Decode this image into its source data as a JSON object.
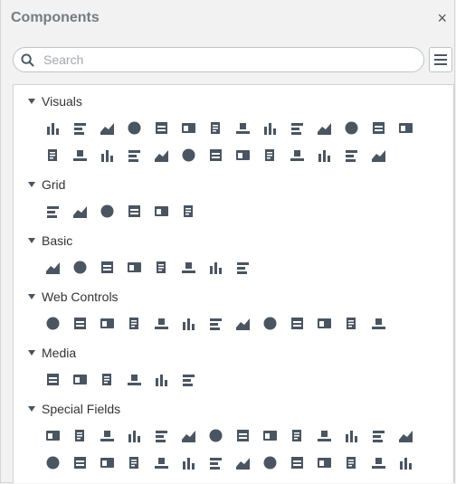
{
  "panel": {
    "title": "Components",
    "close_glyph": "×"
  },
  "search": {
    "placeholder": "Search",
    "value": ""
  },
  "sections": [
    {
      "label": "Visuals",
      "icons": [
        "bar-chart-icon",
        "stacked-bar-chart-icon",
        "100pct-stacked-bar-icon",
        "horizontal-bar-icon",
        "stacked-horizontal-bar-icon",
        "100pct-stacked-horizontal-icon",
        "line-chart-icon",
        "step-line-chart-icon",
        "jump-line-chart-icon",
        "area-chart-icon",
        "stacked-area-chart-icon",
        "100pct-area-chart-icon",
        "combo-chart-icon",
        "pie-chart-icon",
        "donut-chart-icon",
        "half-gauge-icon",
        "gauge-icon",
        "radial-gauge-icon",
        "bullet-icon",
        "dot-plot-icon",
        "scatter-chart-icon",
        "gantt-chart-icon",
        "bubble-chart-icon",
        "tree-chart-icon",
        "treemap-icon",
        "map-icon",
        "kpi-icon"
      ]
    },
    {
      "label": "Grid",
      "icons": [
        "table-icon",
        "freeform-table-icon",
        "crosstab-icon",
        "grouped-table-icon",
        "section-icon",
        "page-grid-icon"
      ]
    },
    {
      "label": "Basic",
      "icons": [
        "text-icon",
        "label-icon",
        "image-icon",
        "subreport-icon",
        "grid-table-icon",
        "spacer-icon",
        "horizontal-line-icon",
        "vertical-line-icon"
      ]
    },
    {
      "label": "Web Controls",
      "icons": [
        "filter-icon",
        "parameter-icon",
        "rectangle-icon",
        "navigator-icon",
        "radio-button-icon",
        "check-box-icon",
        "text-box-icon",
        "list-box-icon",
        "spin-box-icon",
        "lock-icon",
        "image-box-icon",
        "button-ok-icon",
        "image-button-icon"
      ]
    },
    {
      "label": "Media",
      "icons": [
        "signature-icon",
        "barcode-icon",
        "qr-code-icon",
        "java-icon",
        "eye-icon",
        "play-icon"
      ]
    },
    {
      "label": "Special Fields",
      "icons": [
        "print-date-icon",
        "print-time-icon",
        "modified-date-icon",
        "modified-time-icon",
        "create-date-icon",
        "create-time-icon",
        "page-number-icon",
        "author-icon",
        "page-count-icon",
        "sort-icon",
        "group-number-icon",
        "group-count-icon",
        "page-number-of-icon",
        "page-total-icon",
        "report-page-icon",
        "report-page-total-icon",
        "page-index-icon",
        "report-index-icon",
        "sql-icon",
        "filter-dollar-icon",
        "filter-fx-icon",
        "filter-list-icon",
        "filter-arrow-icon",
        "user-ab-icon",
        "parameter-value-icon",
        "database-icon",
        "note-icon",
        "layers-eye-icon",
        "layers-icon"
      ]
    }
  ],
  "icon_color": "#4a5561"
}
